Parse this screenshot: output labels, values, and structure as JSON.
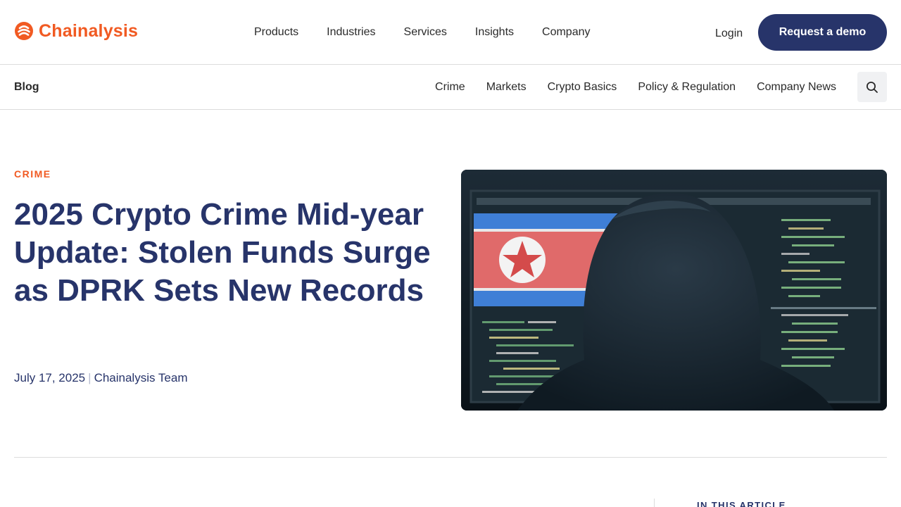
{
  "header": {
    "brand": "Chainalysis",
    "menu": [
      "Products",
      "Industries",
      "Services",
      "Insights",
      "Company"
    ],
    "login": "Login",
    "cta": "Request a demo"
  },
  "subnav": {
    "blog": "Blog",
    "categories": [
      "Crime",
      "Markets",
      "Crypto Basics",
      "Policy & Regulation",
      "Company News"
    ]
  },
  "article": {
    "category": "CRIME",
    "title": "2025 Crypto Crime Mid-year Update: Stolen Funds Surge as DPRK Sets New Records",
    "date": "July 17, 2025",
    "separator": "|",
    "author": "Chainalysis Team"
  },
  "toc": {
    "heading": "IN THIS ARTICLE"
  },
  "colors": {
    "brand_orange": "#f15a22",
    "navy": "#27346a",
    "divider": "#dcdcdc"
  },
  "icons": {
    "logo": "chainalysis-logo-mark",
    "search": "search-icon"
  }
}
